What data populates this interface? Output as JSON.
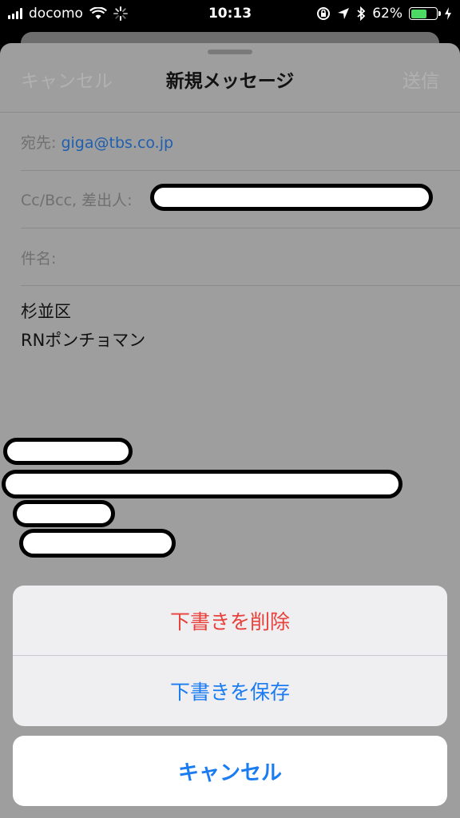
{
  "status_bar": {
    "carrier": "docomo",
    "time": "10:13",
    "battery_percent": "62%",
    "battery_level": 0.62,
    "accent_color": "#4cd964"
  },
  "compose": {
    "nav": {
      "cancel_label": "キャンセル",
      "title": "新規メッセージ",
      "send_label": "送信"
    },
    "to_label": "宛先:",
    "to_value": "giga@tbs.co.jp",
    "cc_label": "Cc/Bcc, 差出人:",
    "subject_label": "件名:",
    "body_lines": [
      "杉並区",
      "RNポンチョマン"
    ]
  },
  "action_sheet": {
    "delete_label": "下書きを削除",
    "save_label": "下書きを保存",
    "cancel_label": "キャンセル",
    "destructive_color": "#e8403a",
    "action_color": "#1b7cf2"
  },
  "icons": [
    "signal-icon",
    "wifi-icon",
    "activity-spinner-icon",
    "orientation-lock-icon",
    "location-icon",
    "bluetooth-icon",
    "battery-icon",
    "charging-icon"
  ]
}
